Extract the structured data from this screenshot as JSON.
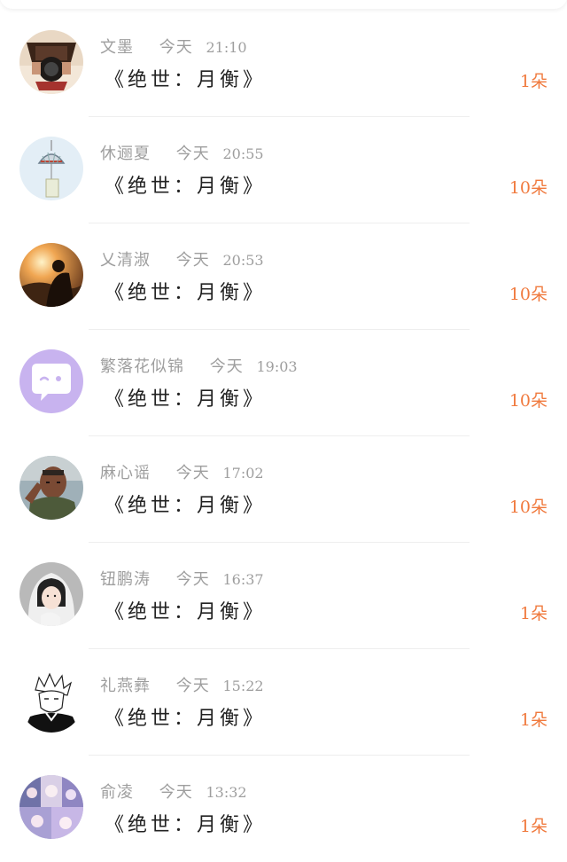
{
  "items": [
    {
      "name": "文墨",
      "day": "今天",
      "time": "21:10",
      "gift": "《绝世：月衡》",
      "count": "1朵",
      "avatar": "avatar-photo-camera"
    },
    {
      "name": "休逦夏",
      "day": "今天",
      "time": "20:55",
      "gift": "《绝世：月衡》",
      "count": "10朵",
      "avatar": "avatar-wind-chime"
    },
    {
      "name": "乂清淑",
      "day": "今天",
      "time": "20:53",
      "gift": "《绝世：月衡》",
      "count": "10朵",
      "avatar": "avatar-sunset-couple"
    },
    {
      "name": "繁落花似锦",
      "day": "今天",
      "time": "19:03",
      "gift": "《绝世：月衡》",
      "count": "10朵",
      "avatar": "avatar-default-chat"
    },
    {
      "name": "麻心谣",
      "day": "今天",
      "time": "17:02",
      "gift": "《绝世：月衡》",
      "count": "10朵",
      "avatar": "avatar-soldier"
    },
    {
      "name": "钮鹏涛",
      "day": "今天",
      "time": "16:37",
      "gift": "《绝世：月衡》",
      "count": "1朵",
      "avatar": "avatar-girl-hood"
    },
    {
      "name": "礼燕彝",
      "day": "今天",
      "time": "15:22",
      "gift": "《绝世：月衡》",
      "count": "1朵",
      "avatar": "avatar-manga-boy"
    },
    {
      "name": "俞凌",
      "day": "今天",
      "time": "13:32",
      "gift": "《绝世：月衡》",
      "count": "1朵",
      "avatar": "avatar-anime-collage"
    }
  ]
}
